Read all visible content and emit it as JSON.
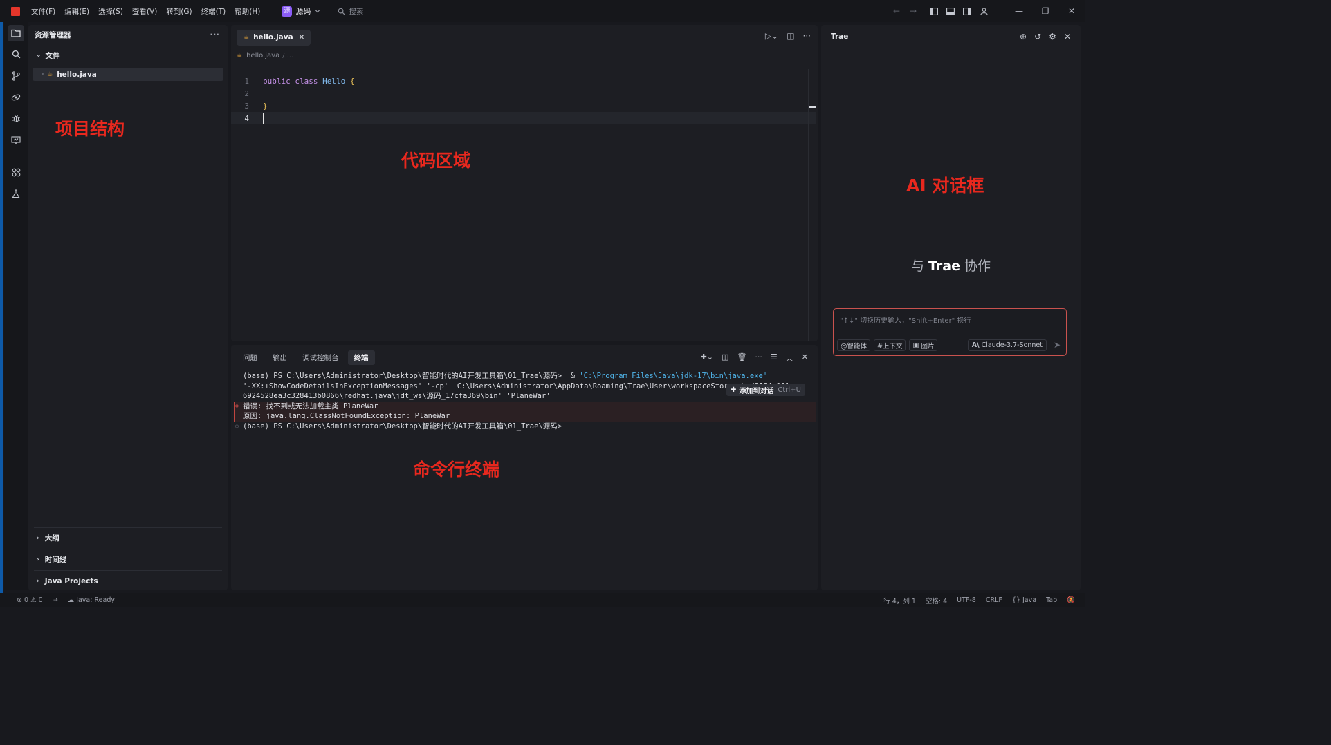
{
  "titlebar": {
    "menus": [
      "文件(F)",
      "编辑(E)",
      "选择(S)",
      "查看(V)",
      "转到(G)",
      "终端(T)",
      "帮助(H)"
    ],
    "project_badge": "源",
    "project_name": "源码",
    "search_placeholder": "搜索"
  },
  "activity_icons": [
    "explorer-icon",
    "search-icon",
    "source-control-icon",
    "remote-icon",
    "debug-icon",
    "preview-icon",
    "extensions-icon",
    "testing-icon"
  ],
  "explorer": {
    "title": "资源管理器",
    "folder": "文件",
    "file": "hello.java",
    "sections": [
      "大纲",
      "时间线",
      "Java Projects"
    ]
  },
  "editor": {
    "tab_label": "hello.java",
    "breadcrumb_file": "hello.java",
    "breadcrumb_rest": "/ ...",
    "lines": [
      {
        "no": "1",
        "kw1": "public",
        "kw2": "class",
        "cls": "Hello",
        "brace": "{"
      },
      {
        "no": "2"
      },
      {
        "no": "3",
        "brace": "}"
      },
      {
        "no": "4"
      }
    ]
  },
  "terminal": {
    "tabs": [
      "问题",
      "输出",
      "调试控制台",
      "终端"
    ],
    "active_tab": "终端",
    "line1_prompt": "(base) PS C:\\Users\\Administrator\\Desktop\\智能时代的AI开发工具箱\\01_Trae\\源码>  & ",
    "line1_path": "'C:\\Program Files\\Java\\jdk-17\\bin\\java.exe'",
    "line2": "'-XX:+ShowCodeDetailsInExceptionMessages' '-cp' 'C:\\Users\\Administrator\\AppData\\Roaming\\Trae\\User\\workspaceStorage\\ed3184c961",
    "line3": "6924528ea3c328413b0866\\redhat.java\\jdt_ws\\源码_17cfa369\\bin' 'PlaneWar'",
    "error1": "错误: 找不到或无法加载主类 PlaneWar",
    "error2": "原因: java.lang.ClassNotFoundException: PlaneWar",
    "prompt_final": "(base) PS C:\\Users\\Administrator\\Desktop\\智能时代的AI开发工具箱\\01_Trae\\源码>",
    "add_to_chat": "添加到对话",
    "add_to_chat_kbd": "Ctrl+U"
  },
  "ai_panel": {
    "title": "Trae",
    "collab_prefix": "与",
    "collab_brand": "Trae",
    "collab_suffix": "协作",
    "input_placeholder": "\"↑↓\" 切换历史输入，\"Shift+Enter\" 换行",
    "chips": [
      "@智能体",
      "#上下文",
      "图片"
    ],
    "model": "Claude-3.7-Sonnet"
  },
  "annotations": {
    "project": "项目结构",
    "code": "代码区域",
    "ai": "AI 对话框",
    "terminal": "命令行终端"
  },
  "statusbar": {
    "errors": "0",
    "warnings": "0",
    "java_status": "Java: Ready",
    "position": "行 4，列 1",
    "spaces": "空格: 4",
    "encoding": "UTF-8",
    "eol": "CRLF",
    "language": "Java",
    "tab": "Tab"
  },
  "colors": {
    "accent_red": "#e8281e",
    "keyword": "#c792ea",
    "class_name": "#7fb6e8",
    "brace": "#f0c65a",
    "terminal_path": "#4fb3e8"
  }
}
